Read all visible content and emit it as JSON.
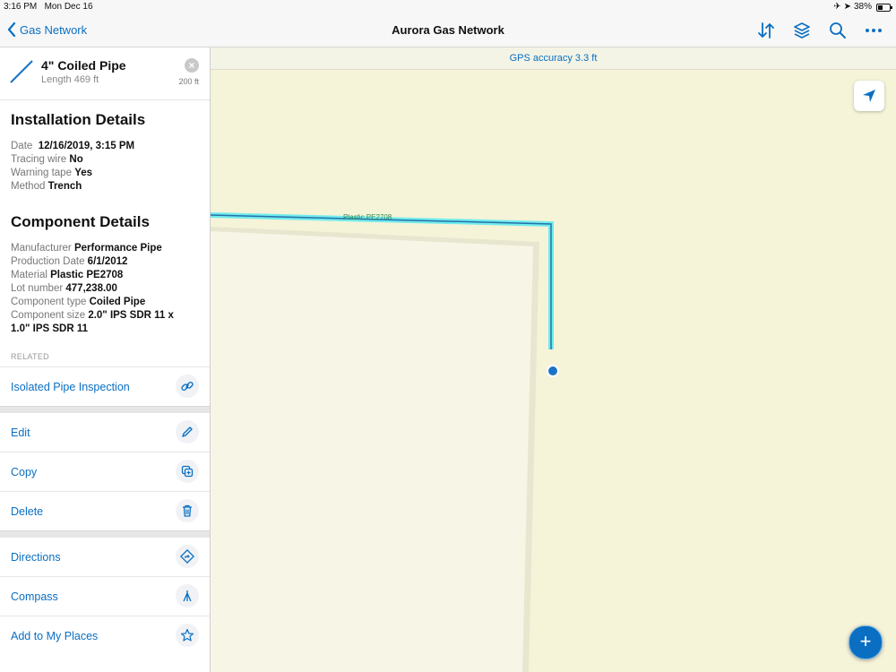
{
  "status": {
    "time": "3:16 PM",
    "date": "Mon Dec 16",
    "battery": "38%"
  },
  "nav": {
    "back_label": "Gas Network",
    "title": "Aurora Gas Network",
    "icons": [
      "sort-icon",
      "layers-icon",
      "search-icon",
      "more-icon"
    ]
  },
  "gps": {
    "text": "GPS accuracy 3.3 ft"
  },
  "feature": {
    "title": "4\" Coiled Pipe",
    "subtitle": "Length 469 ft",
    "distance": "200 ft"
  },
  "installation": {
    "heading": "Installation Details",
    "fields": [
      {
        "label": "Date",
        "value": "12/16/2019, 3:15 PM"
      },
      {
        "label": "Tracing wire",
        "value": "No"
      },
      {
        "label": "Warning tape",
        "value": "Yes"
      },
      {
        "label": "Method",
        "value": "Trench"
      }
    ]
  },
  "component": {
    "heading": "Component Details",
    "fields": [
      {
        "label": "Manufacturer",
        "value": "Performance Pipe"
      },
      {
        "label": "Production Date",
        "value": "6/1/2012"
      },
      {
        "label": "Material",
        "value": "Plastic PE2708"
      },
      {
        "label": "Lot number",
        "value": "477,238.00"
      },
      {
        "label": "Component type",
        "value": "Coiled Pipe"
      },
      {
        "label": "Component size",
        "value": "2.0\" IPS SDR 11 x 1.0\" IPS SDR 11"
      }
    ]
  },
  "related": {
    "heading": "RELATED",
    "item": "Isolated Pipe Inspection"
  },
  "actions": {
    "edit": "Edit",
    "copy": "Copy",
    "delete": "Delete"
  },
  "nav_actions": {
    "directions": "Directions",
    "compass": "Compass",
    "places": "Add to My Places"
  },
  "map": {
    "pipe_label": "Plastic PE2708",
    "pipe_color": "#00e5ff",
    "gps_dot_color": "#1a73c9"
  },
  "fab": {
    "label": "+"
  }
}
